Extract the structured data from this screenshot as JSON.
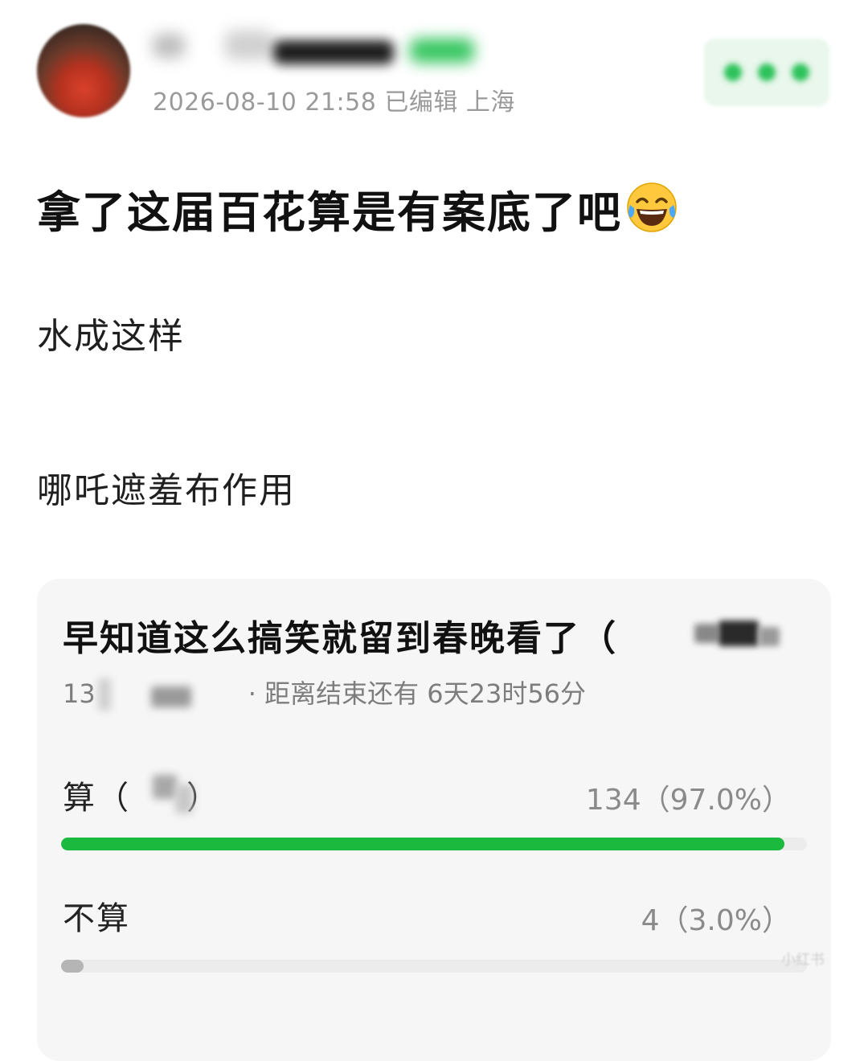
{
  "header": {
    "meta": "2026-08-10 21:58  已编辑  上海"
  },
  "post": {
    "title": "拿了这届百花算是有案底了吧",
    "lines": [
      "水成这样",
      "哪吒遮羞布作用"
    ]
  },
  "poll": {
    "title": "早知道这么搞笑就留到春晚看了（",
    "meta_prefix": "13",
    "meta_suffix": "· 距离结束还有 6天23时56分",
    "options": [
      {
        "label": "算（",
        "label_tail": "）",
        "count": "134（97.0%）",
        "fraction": 0.97,
        "color": "#1cb93f"
      },
      {
        "label": "不算",
        "label_tail": "",
        "count": "4（3.0%）",
        "fraction": 0.03,
        "color": "#b5b5b5"
      }
    ]
  },
  "watermark": "小红书",
  "colors": {
    "accent": "#1cb93f",
    "meta_text": "#9a9a9a"
  }
}
